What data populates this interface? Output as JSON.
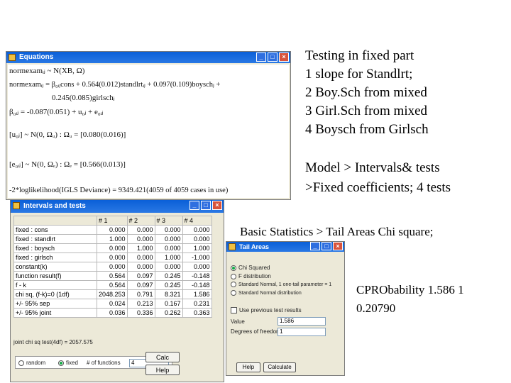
{
  "slide": {
    "right_top_lines": [
      "Testing in fixed part",
      "1 slope for Standlrt;",
      "2 Boy.Sch from mixed",
      "3 Girl.Sch from mixed",
      "4 Boysch from Girlsch"
    ],
    "right_mid_lines": [
      "Model > Intervals& tests",
      ">Fixed coefficients; 4 tests"
    ],
    "basic_stats": "Basic Statistics >  Tail Areas  Chi square;",
    "cprob_lines": [
      "CPRObability 1.586 1",
      " 0.20790"
    ]
  },
  "equations_window": {
    "title": "Equations",
    "lines": [
      "normexamᵢⱼ ~ N(XB, Ω)",
      "normexamᵢⱼ = β₀ᵢⱼcons + 0.564(0.012)standlrtᵢⱼ + 0.097(0.109)boyschⱼ +",
      "0.245(0.085)girlschⱼ",
      "β₀ᵢⱼ = -0.087(0.051) + u₀ⱼ + e₀ᵢⱼ",
      "[u₀ⱼ] ~ N(0,  Ωᵤ) :  Ωᵤ = [0.080(0.016)]",
      "[e₀ᵢⱼ] ~ N(0,  Ωₑ) :  Ωₑ = [0.566(0.013)]",
      "-2*loglikelihood(IGLS Deviance) = 9349.421(4059 of 4059 cases in use)"
    ]
  },
  "intervals_window": {
    "title": "Intervals and tests",
    "headers": [
      "",
      "# 1",
      "# 2",
      "# 3",
      "# 4"
    ],
    "rows": [
      [
        "fixed : cons",
        "0.000",
        "0.000",
        "0.000",
        "0.000"
      ],
      [
        "fixed : standlrt",
        "1.000",
        "0.000",
        "0.000",
        "0.000"
      ],
      [
        "fixed : boysch",
        "0.000",
        "1.000",
        "0.000",
        "1.000"
      ],
      [
        "fixed : girlsch",
        "0.000",
        "0.000",
        "1.000",
        "-1.000"
      ],
      [
        "constant(k)",
        "0.000",
        "0.000",
        "0.000",
        "0.000"
      ],
      [
        "function result(f)",
        "0.564",
        "0.097",
        "0.245",
        "-0.148"
      ],
      [
        "f - k",
        "0.564",
        "0.097",
        "0.245",
        "-0.148"
      ],
      [
        "chi sq, (f-k)=0 (1df)",
        "2048.253",
        "0.791",
        "8.321",
        "1.586"
      ],
      [
        "+/- 95% sep",
        "0.024",
        "0.213",
        "0.167",
        "0.231"
      ],
      [
        "+/- 95% joint",
        "0.036",
        "0.336",
        "0.262",
        "0.363"
      ]
    ],
    "joint_chi": "joint chi sq test(4df) = 2057.575",
    "radio_random": "random",
    "radio_fixed": "fixed",
    "functions_label": "# of functions",
    "functions_value": "4",
    "calc_button": "Calc",
    "help_button": "Help"
  },
  "tail_window": {
    "title": "Tail Areas",
    "options": [
      "Chi Squared",
      "F distribution",
      "Standard Normal, 1 one-tail parameter = 1",
      "Standard Normal distribution"
    ],
    "checkbox_label": "Use previous test results",
    "value_label": "Value",
    "value": "1.586",
    "dof_label": "Degrees of freedom",
    "dof": "1",
    "help_button": "Help",
    "calculate_button": "Calculate"
  }
}
